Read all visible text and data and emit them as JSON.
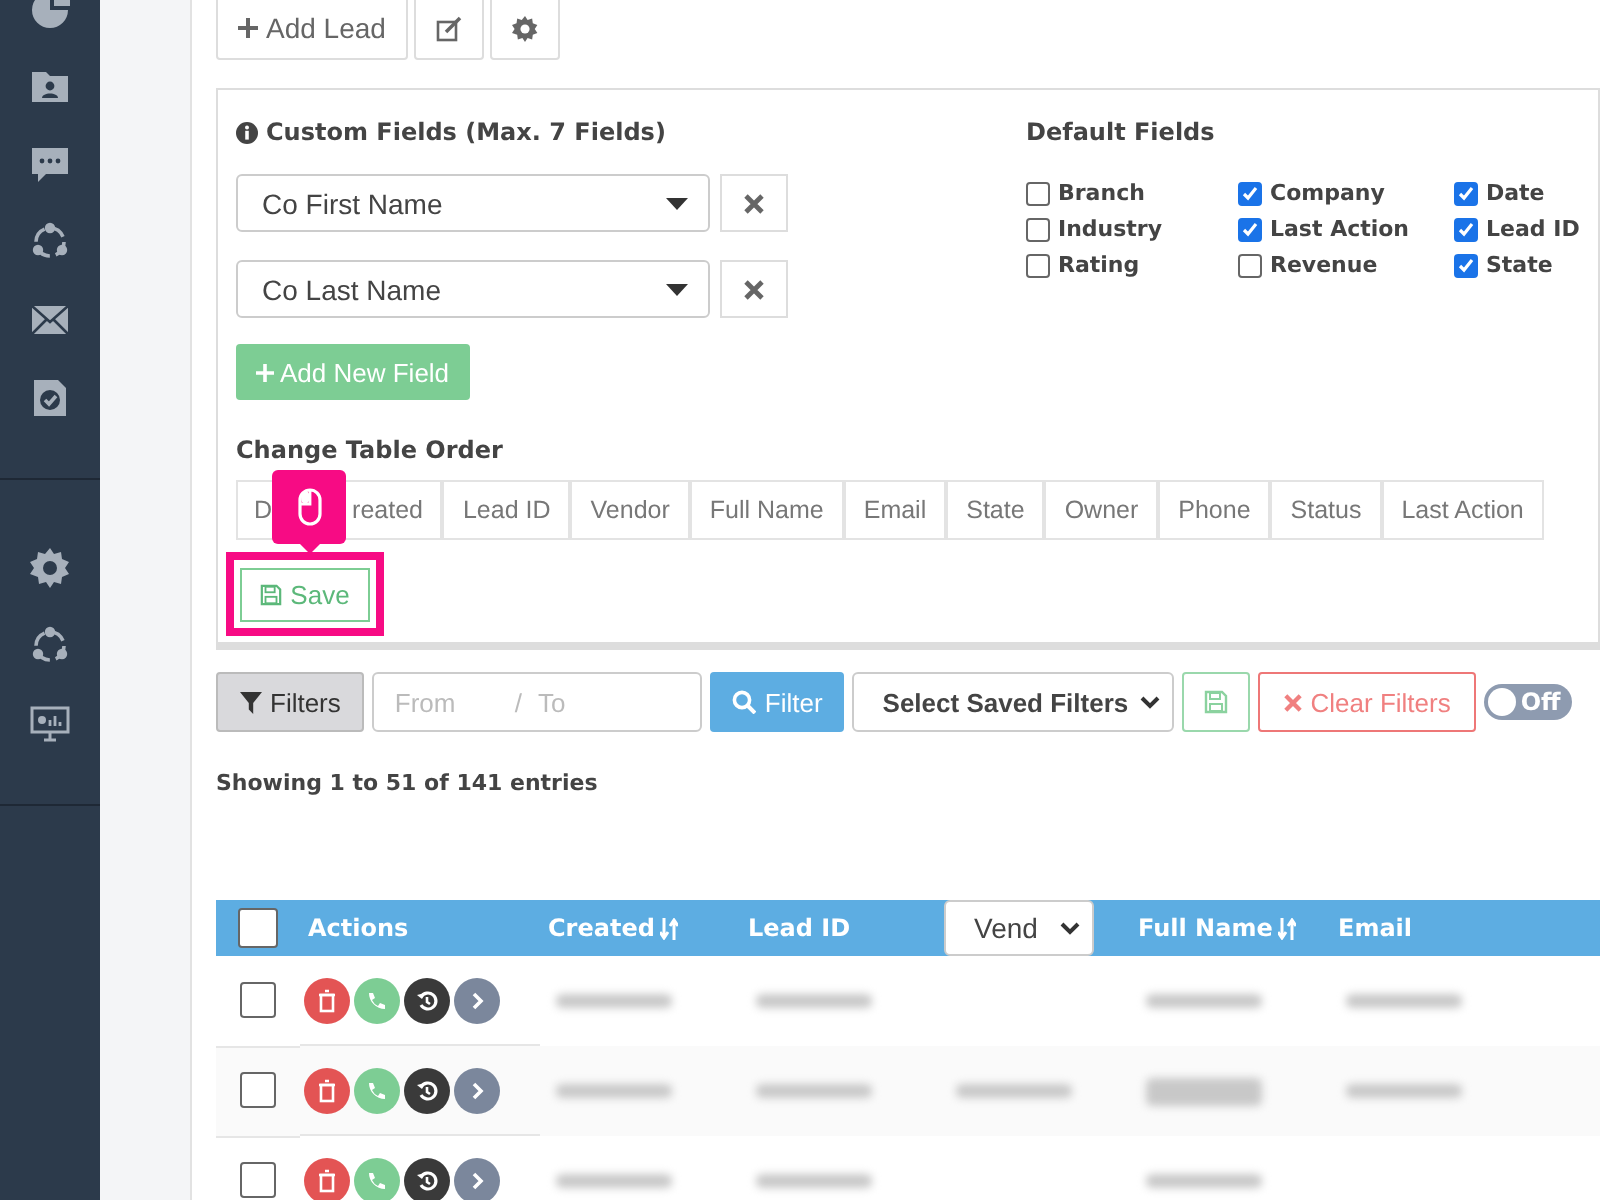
{
  "toolbar": {
    "add_lead": "Add Lead"
  },
  "custom_fields": {
    "title": "Custom Fields (Max. 7 Fields)",
    "fields": [
      {
        "value": "Co First Name"
      },
      {
        "value": "Co Last Name"
      }
    ],
    "add_button": "Add New Field"
  },
  "default_fields": {
    "title": "Default Fields",
    "items": [
      {
        "label": "Branch",
        "checked": false
      },
      {
        "label": "Company",
        "checked": true
      },
      {
        "label": "Date",
        "checked": true
      },
      {
        "label": "Industry",
        "checked": false
      },
      {
        "label": "Last Action",
        "checked": true
      },
      {
        "label": "Lead ID",
        "checked": true
      },
      {
        "label": "Rating",
        "checked": false
      },
      {
        "label": "Revenue",
        "checked": false
      },
      {
        "label": "State",
        "checked": true
      }
    ]
  },
  "table_order": {
    "title": "Change Table Order",
    "columns": [
      {
        "kind": "covered",
        "label_start": "D",
        "label_end": "reated"
      },
      {
        "kind": "plain",
        "label": "Lead ID"
      },
      {
        "kind": "plain",
        "label": "Vendor"
      },
      {
        "kind": "plain",
        "label": "Full Name"
      },
      {
        "kind": "plain",
        "label": "Email"
      },
      {
        "kind": "plain",
        "label": "State"
      },
      {
        "kind": "plain",
        "label": "Owner"
      },
      {
        "kind": "plain",
        "label": "Phone"
      },
      {
        "kind": "plain",
        "label": "Status"
      },
      {
        "kind": "plain",
        "label": "Last Action"
      }
    ],
    "save_button": "Save",
    "highlighted": true
  },
  "filters": {
    "filters_button": "Filters",
    "from_placeholder": "From",
    "separator": "/",
    "to_placeholder": "To",
    "filter_button": "Filter",
    "saved_filters": "Select Saved Filters",
    "clear_button": "Clear Filters",
    "toggle": {
      "label": "Off",
      "on": false
    }
  },
  "summary": "Showing 1 to 51 of 141 entries",
  "table": {
    "select_all": false,
    "columns": [
      {
        "label": "Actions",
        "kind": "plain"
      },
      {
        "label": "Created",
        "kind": "sortable"
      },
      {
        "label": "Lead ID",
        "kind": "plain"
      },
      {
        "label": "Vend",
        "kind": "select"
      },
      {
        "label": "Full Name",
        "kind": "sortable"
      },
      {
        "label": "Email",
        "kind": "plain"
      }
    ],
    "rows": [
      {
        "selected": false,
        "cells": [
          {
            "kind": "blurred"
          },
          {
            "kind": "blurred"
          },
          {
            "kind": "empty"
          },
          {
            "kind": "blurred"
          },
          {
            "kind": "blurred"
          }
        ]
      },
      {
        "selected": false,
        "cells": [
          {
            "kind": "blurred"
          },
          {
            "kind": "blurred"
          },
          {
            "kind": "blurred"
          },
          {
            "kind": "blurred2"
          },
          {
            "kind": "blurred"
          }
        ]
      },
      {
        "selected": false,
        "cells": [
          {
            "kind": "blurred"
          },
          {
            "kind": "blurred"
          },
          {
            "kind": "empty"
          },
          {
            "kind": "blurred"
          },
          {
            "kind": "empty"
          }
        ]
      }
    ]
  }
}
